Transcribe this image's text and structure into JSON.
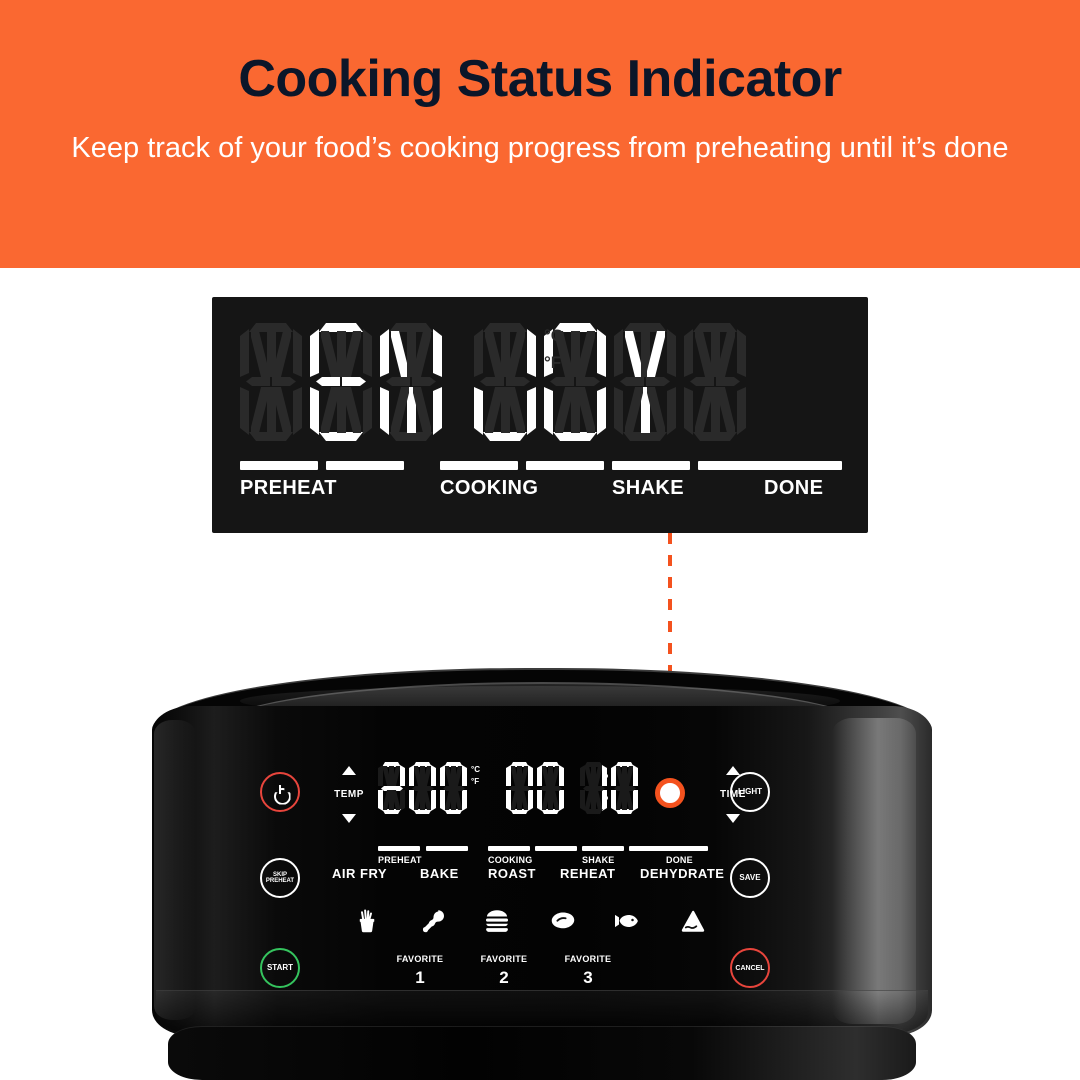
{
  "banner": {
    "title": "Cooking Status Indicator",
    "subtitle": "Keep track of your food’s cooking progress from preheating until it’s done",
    "bg_color": "#FA6831",
    "title_color": "#0B1629",
    "subtitle_color": "#FFFFFF"
  },
  "display": {
    "message": "EN JOY",
    "characters": [
      "",
      "E",
      "N",
      "J",
      "O",
      "Y",
      ""
    ],
    "unit_celsius": "°C",
    "unit_fahrenheit": "°F",
    "bars": [
      {
        "label": "PREHEAT",
        "lit": true
      },
      {
        "label": "",
        "lit": true
      },
      {
        "label": "COOKING",
        "lit": true
      },
      {
        "label": "",
        "lit": true
      },
      {
        "label": "SHAKE",
        "lit": true
      },
      {
        "label": "",
        "lit": true
      },
      {
        "label": "DONE",
        "lit": true
      }
    ],
    "stage_labels": [
      "PREHEAT",
      "COOKING",
      "SHAKE",
      "DONE"
    ],
    "bg_color": "#151515",
    "lit_color": "#FFFFFF",
    "dim_color": "#2A2A2A"
  },
  "callout": {
    "line_color": "#F4521E",
    "marker_fill": "#FFFFFF",
    "marker_ring": "#F4521E",
    "style": "dashed"
  },
  "appliance": {
    "name": "air-fryer",
    "body_color": "#050505",
    "panel": {
      "temperature_value": "200",
      "temperature_units": [
        "°C",
        "°F"
      ],
      "time_value": "00:10",
      "time_digits": [
        "0",
        "0",
        "1",
        "0"
      ],
      "temp_label": "TEMP",
      "time_label": "TIME",
      "stage_labels": [
        "PREHEAT",
        "COOKING",
        "SHAKE",
        "DONE"
      ],
      "buttons_left": [
        {
          "name": "power",
          "label": "",
          "color": "#E8453C"
        },
        {
          "name": "skip-preheat",
          "label": "SKIP PREHEAT",
          "color": "#FFFFFF"
        },
        {
          "name": "start",
          "label": "START",
          "color": "#35C45E"
        }
      ],
      "buttons_right": [
        {
          "name": "light",
          "label": "LIGHT",
          "color": "#FFFFFF"
        },
        {
          "name": "save",
          "label": "SAVE",
          "color": "#FFFFFF"
        },
        {
          "name": "cancel",
          "label": "CANCEL",
          "color": "#E8453C"
        }
      ],
      "modes": [
        "AIR FRY",
        "BAKE",
        "ROAST",
        "REHEAT",
        "DEHYDRATE"
      ],
      "food_presets": [
        "fries-icon",
        "chicken-drumstick-icon",
        "burger-icon",
        "steak-icon",
        "fish-icon",
        "cake-icon"
      ],
      "favorites": [
        {
          "label": "FAVORITE",
          "number": "1"
        },
        {
          "label": "FAVORITE",
          "number": "2"
        },
        {
          "label": "FAVORITE",
          "number": "3"
        }
      ]
    }
  }
}
